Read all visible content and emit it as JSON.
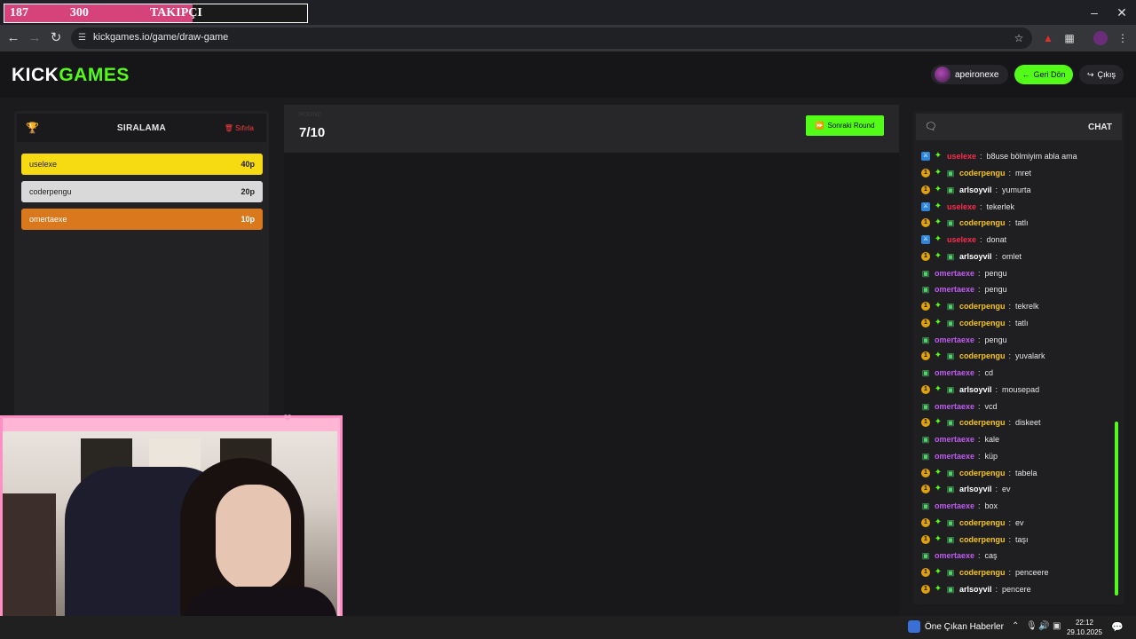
{
  "overlay": {
    "count": "187",
    "label": "TAKIPÇI",
    "goal": "300",
    "progress": 0.623
  },
  "browser": {
    "url": "kickgames.io/game/draw-game"
  },
  "header": {
    "logo_part1": "KICK",
    "logo_part2": "GAMES",
    "username": "apeironexe",
    "back_label": "Geri Dön",
    "exit_label": "Çıkış"
  },
  "leaderboard": {
    "title": "SIRALAMA",
    "reset_label": "Sıfırla",
    "rows": [
      {
        "name": "uselexe",
        "points": "40p",
        "color": "#f6db12"
      },
      {
        "name": "coderpengu",
        "points": "20p",
        "color": "#d9d9d9"
      },
      {
        "name": "omertaexe",
        "points": "10p",
        "color": "#d9781d"
      }
    ]
  },
  "round": {
    "label": "ROUND",
    "value": "7/10",
    "next_label": "Sonraki Round"
  },
  "chat": {
    "title": "CHAT",
    "messages": [
      {
        "user": "uselexe",
        "text": "b8use bölmiyim abla ama",
        "badges": [
          "mod",
          "spark"
        ],
        "color": "#ff2a4f"
      },
      {
        "user": "coderpengu",
        "text": "mret",
        "badges": [
          "vip",
          "spark",
          "gift"
        ],
        "color": "#f5c518"
      },
      {
        "user": "arlsoyvil",
        "text": "yumurta",
        "badges": [
          "vip",
          "spark",
          "gift"
        ],
        "color": "#ffffff"
      },
      {
        "user": "uselexe",
        "text": "tekerlek",
        "badges": [
          "mod",
          "spark"
        ],
        "color": "#ff2a4f"
      },
      {
        "user": "coderpengu",
        "text": "tatlı",
        "badges": [
          "vip",
          "spark",
          "gift"
        ],
        "color": "#f5c518"
      },
      {
        "user": "uselexe",
        "text": "donat",
        "badges": [
          "mod",
          "spark"
        ],
        "color": "#ff2a4f"
      },
      {
        "user": "arlsoyvil",
        "text": "omlet",
        "badges": [
          "vip",
          "spark",
          "gift"
        ],
        "color": "#ffffff"
      },
      {
        "user": "omertaexe",
        "text": "pengu",
        "badges": [
          "gift"
        ],
        "color": "#c05cf0"
      },
      {
        "user": "omertaexe",
        "text": "pengu",
        "badges": [
          "gift"
        ],
        "color": "#c05cf0"
      },
      {
        "user": "coderpengu",
        "text": "tekrelk",
        "badges": [
          "vip",
          "spark",
          "gift"
        ],
        "color": "#f5c518"
      },
      {
        "user": "coderpengu",
        "text": "tatlı",
        "badges": [
          "vip",
          "spark",
          "gift"
        ],
        "color": "#f5c518"
      },
      {
        "user": "omertaexe",
        "text": "pengu",
        "badges": [
          "gift"
        ],
        "color": "#c05cf0"
      },
      {
        "user": "coderpengu",
        "text": "yuvalark",
        "badges": [
          "vip",
          "spark",
          "gift"
        ],
        "color": "#f5c518"
      },
      {
        "user": "omertaexe",
        "text": "cd",
        "badges": [
          "gift"
        ],
        "color": "#c05cf0"
      },
      {
        "user": "arlsoyvil",
        "text": "mousepad",
        "badges": [
          "vip",
          "spark",
          "gift"
        ],
        "color": "#ffffff"
      },
      {
        "user": "omertaexe",
        "text": "vcd",
        "badges": [
          "gift"
        ],
        "color": "#c05cf0"
      },
      {
        "user": "coderpengu",
        "text": "diskeet",
        "badges": [
          "vip",
          "spark",
          "gift"
        ],
        "color": "#f5c518"
      },
      {
        "user": "omertaexe",
        "text": "kale",
        "badges": [
          "gift"
        ],
        "color": "#c05cf0"
      },
      {
        "user": "omertaexe",
        "text": "küp",
        "badges": [
          "gift"
        ],
        "color": "#c05cf0"
      },
      {
        "user": "coderpengu",
        "text": "tabela",
        "badges": [
          "vip",
          "spark",
          "gift"
        ],
        "color": "#f5c518"
      },
      {
        "user": "arlsoyvil",
        "text": "ev",
        "badges": [
          "vip",
          "spark",
          "gift"
        ],
        "color": "#ffffff"
      },
      {
        "user": "omertaexe",
        "text": "box",
        "badges": [
          "gift"
        ],
        "color": "#c05cf0"
      },
      {
        "user": "coderpengu",
        "text": "ev",
        "badges": [
          "vip",
          "spark",
          "gift"
        ],
        "color": "#f5c518"
      },
      {
        "user": "coderpengu",
        "text": "taşı",
        "badges": [
          "vip",
          "spark",
          "gift"
        ],
        "color": "#f5c518"
      },
      {
        "user": "omertaexe",
        "text": "caş",
        "badges": [
          "gift"
        ],
        "color": "#c05cf0"
      },
      {
        "user": "coderpengu",
        "text": "penceere",
        "badges": [
          "vip",
          "spark",
          "gift"
        ],
        "color": "#f5c518"
      },
      {
        "user": "arlsoyvil",
        "text": "pencere",
        "badges": [
          "vip",
          "spark",
          "gift"
        ],
        "color": "#ffffff"
      }
    ]
  },
  "taskbar": {
    "news_label": "Öne Çıkan Haberler",
    "time": "22:12",
    "date": "29.10.2025"
  },
  "colors": {
    "accent": "#53fc18",
    "pink": "#ff8fc3"
  }
}
